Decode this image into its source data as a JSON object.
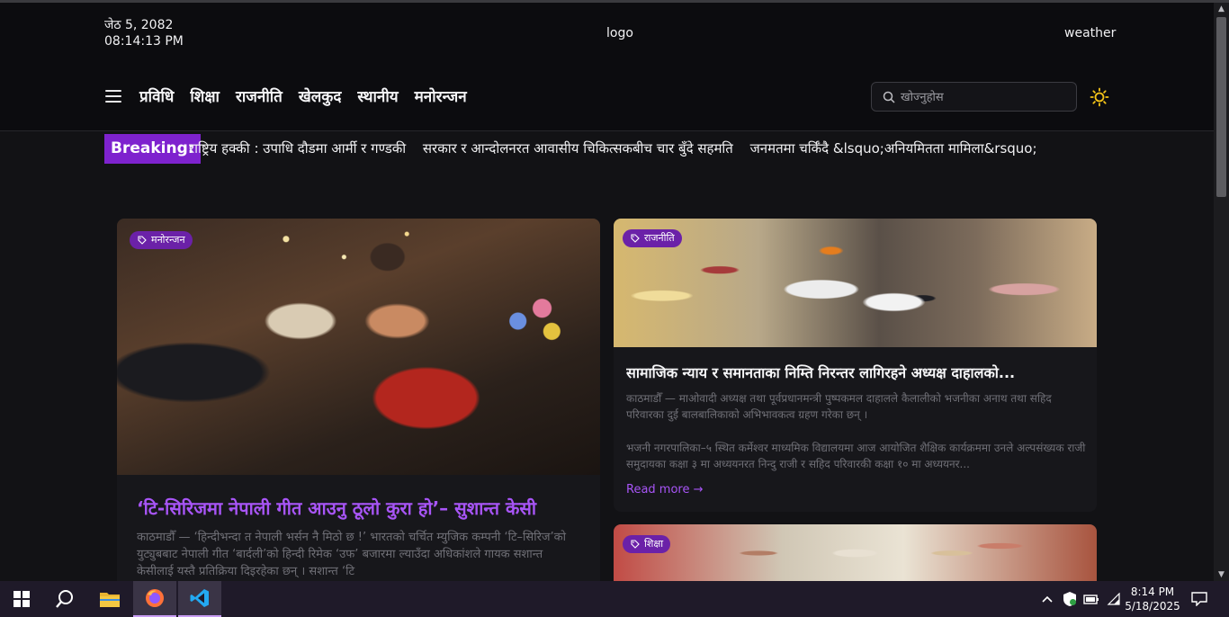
{
  "header": {
    "date": "जेठ 5, 2082",
    "time": "08:14:13 PM",
    "logo": "logo",
    "weather": "weather"
  },
  "nav": {
    "items": [
      "प्रविधि",
      "शिक्षा",
      "राजनीति",
      "खेलकुद",
      "स्थानीय",
      "मनोरन्जन"
    ],
    "search_placeholder": "खोज्नुहोस"
  },
  "breaking": {
    "label": "Breaking:",
    "items": [
      "राष्ट्रिय हक्की : उपाधि दौडमा आर्मी र गण्डकी",
      "सरकार र आन्दोलनरत आवासीय चिकित्सकबीच चार बुँदे सहमति",
      "जनमतमा चर्किँदै &lsquo;अनियमितता मामिला&rsquo;"
    ]
  },
  "featured": {
    "tag": "मनोरन्जन",
    "title": "‘टि-सिरिजमा नेपाली गीत आउनु ठूलो कुरा हो’– सुशान्त केसी",
    "excerpt": "काठमाडौँ — ‘हिन्दीभन्दा त नेपाली भर्सन नै मिठो छ !’ भारतको चर्चित म्युजिक कम्पनी ‘टि–सिरिज’को युट्युबबाट नेपाली गीत ‘बार्दली’को हिन्दी रिमेक ‘उफ’ बजारमा ल्याउँदा अधिकांशले गायक सशान्त केसीलाई यस्तै प्रतिक्रिया दिइरहेका छन् । सशान्त ‘टि"
  },
  "side_article": {
    "tag": "राजनीति",
    "title": "सामाजिक न्याय र समानताका निम्ति निरन्तर लागिरहने अध्यक्ष दाहालको...",
    "para1": "काठमाडौँ — माओवादी अध्यक्ष तथा पूर्वप्रधानमन्त्री पुष्पकमल दाहालले कैलालीको भजनीका अनाथ तथा सहिद परिवारका दुई बालबालिकाको अभिभावकत्व ग्रहण गरेका छन् ।",
    "para2": "भजनी नगरपालिका–५ स्थित कर्मेश्वर माध्यमिक विद्यालयमा आज आयोजित शैक्षिक कार्यक्रममा उनले अल्पसंख्यक राजी समुदायका कक्षा ३ मा अध्ययनरत निन्दु राजी र सहिद परिवारकी कक्षा १० मा अध्ययनर...",
    "read_more": "Read more →"
  },
  "side_article2": {
    "tag": "शिक्षा"
  },
  "taskbar": {
    "time": "8:14 PM",
    "date": "5/18/2025"
  },
  "colors": {
    "accent": "#7e22ce",
    "link": "#a855f7",
    "background": "#121215"
  }
}
